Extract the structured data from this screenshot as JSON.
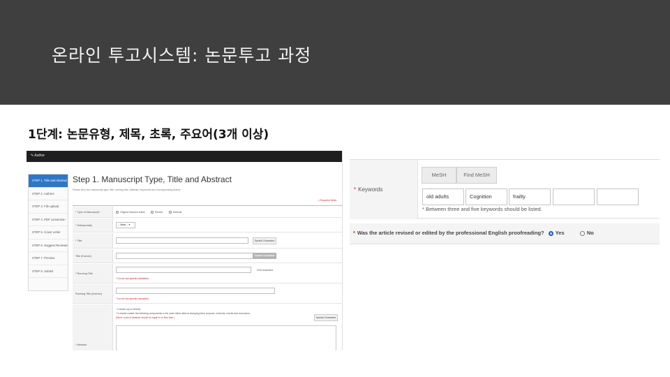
{
  "slide": {
    "title": "온라인 투고시스템: 논문투고 과정",
    "step_heading": "1단계: 논문유형, 제목, 초록, 주요어(3개 이상)"
  },
  "left_screenshot": {
    "topbar_label": "✎ Author",
    "steps": [
      "STEP 1. Title and Abstract",
      "STEP 2. Authors",
      "STEP 3. File upload",
      "STEP 4. PDF conversion",
      "STEP 5. Cover Letter",
      "STEP 6. Suggest Reviewers",
      "STEP 7. Preview",
      "STEP 8. Submit"
    ],
    "form_title": "Step 1. Manuscript Type, Title and Abstract",
    "form_subtitle": "Please fill in the manuscript type, title, running title, abstract, keywords and Corresponding Author.",
    "required_note": "• Required fields",
    "type_label": "* Type of Manuscript",
    "type_options": [
      "Original research article",
      "Review",
      "Editorial"
    ],
    "subspecialty_label": "* Subspecialty",
    "subspecialty_value": "-- None --",
    "title_label": "* Title",
    "special_chars": "Special Characters",
    "title_korean_label": "Title (Korean)",
    "running_title_label": "* Running Title",
    "char_count": "0/40 characters",
    "no_special_warning": "* Do not use special characters",
    "running_title_korean_label": "Running Title (Korean)",
    "abstract_label": "* Abstract",
    "abstract_words": "-  0  words (up to  Words)",
    "abstract_note": "* It should contain the following components in the order listed without changing lines: purpose, methods, results and conclusion.",
    "abstract_warning": "(Word count of abstract should be equal to or less than )"
  },
  "right_screenshot": {
    "keywords_label": "Keywords",
    "mesh_browser": "MeSH browser",
    "find_mesh": "Find MeSH Terms",
    "keywords": [
      "old adults",
      "Cognition",
      "frailty",
      "",
      ""
    ],
    "keyword_hint": "* Between three and five keywords should be listed.",
    "question": "Was the article revised or edited by the professional English proofreading?",
    "answer_yes": "Yes",
    "answer_no": "No",
    "selected_answer": "Yes"
  },
  "colors": {
    "header_band": "#3f3f3f",
    "active_step": "#2f77c6",
    "required_marker": "#dd2222"
  }
}
